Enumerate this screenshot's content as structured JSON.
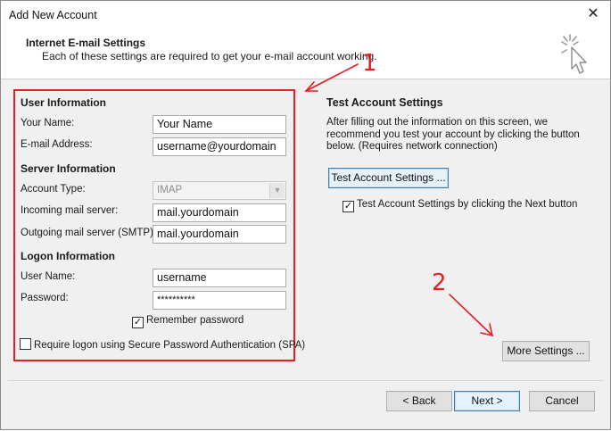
{
  "window": {
    "title": "Add New Account"
  },
  "header": {
    "title": "Internet E-mail Settings",
    "subtitle": "Each of these settings are required to get your e-mail account working."
  },
  "form": {
    "user_info_head": "User Information",
    "your_name_label": "Your Name:",
    "your_name_value": "Your Name",
    "email_label": "E-mail Address:",
    "email_value": "username@yourdomain",
    "server_info_head": "Server Information",
    "account_type_label": "Account Type:",
    "account_type_value": "IMAP",
    "incoming_label": "Incoming mail server:",
    "incoming_value": "mail.yourdomain",
    "outgoing_label": "Outgoing mail server (SMTP):",
    "outgoing_value": "mail.yourdomain",
    "logon_info_head": "Logon Information",
    "username_label": "User Name:",
    "username_value": "username",
    "password_label": "Password:",
    "password_value": "**********",
    "remember_label": "Remember password",
    "remember_checked": true,
    "spa_label": "Require logon using Secure Password Authentication (SPA)",
    "spa_checked": false
  },
  "test": {
    "head": "Test Account Settings",
    "desc": "After filling out the information on this screen, we recommend you test your account by clicking the button below. (Requires network connection)",
    "button_label": "Test Account Settings ...",
    "auto_label": "Test Account Settings by clicking the Next button",
    "auto_checked": true
  },
  "more_settings_label": "More Settings ...",
  "footer": {
    "back": "< Back",
    "next": "Next >",
    "cancel": "Cancel"
  },
  "annotations": {
    "one": "1",
    "two": "2",
    "color": "#e51d24"
  }
}
